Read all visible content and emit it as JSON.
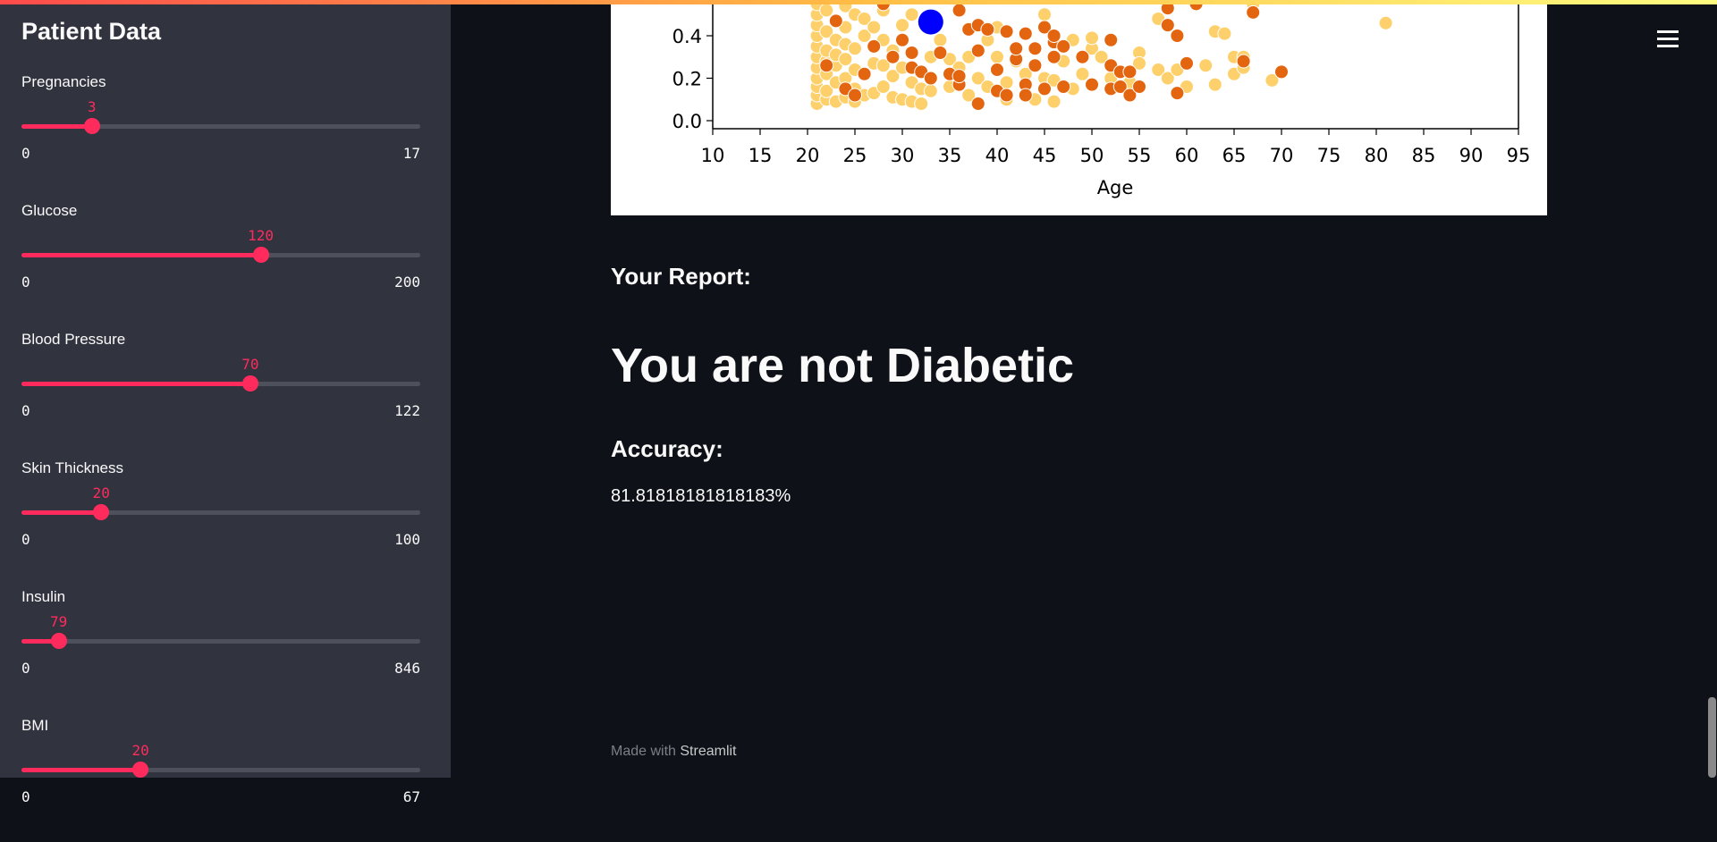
{
  "sidebar": {
    "title": "Patient Data",
    "sliders": [
      {
        "label": "Pregnancies",
        "value": 3,
        "min": 0,
        "max": 17
      },
      {
        "label": "Glucose",
        "value": 120,
        "min": 0,
        "max": 200
      },
      {
        "label": "Blood Pressure",
        "value": 70,
        "min": 0,
        "max": 122
      },
      {
        "label": "Skin Thickness",
        "value": 20,
        "min": 0,
        "max": 100
      },
      {
        "label": "Insulin",
        "value": 79,
        "min": 0,
        "max": 846
      },
      {
        "label": "BMI",
        "value": 20,
        "min": 0,
        "max": 67
      }
    ],
    "accent_color": "#ff2b5c"
  },
  "main": {
    "report_heading": "Your Report:",
    "verdict": "You are not Diabetic",
    "accuracy_heading": "Accuracy:",
    "accuracy_value": "81.81818181818183%",
    "footer_prefix": "Made with ",
    "footer_brand": "Streamlit",
    "menu_icon": "hamburger-icon"
  },
  "chart_data": {
    "type": "scatter",
    "xlabel": "Age",
    "xlim": [
      10,
      95
    ],
    "xticks": [
      10,
      15,
      20,
      25,
      30,
      35,
      40,
      45,
      50,
      55,
      60,
      65,
      70,
      75,
      80,
      85,
      90,
      95
    ],
    "yticks": [
      "0.0",
      "0.2",
      "0.4"
    ],
    "ylim_visible": [
      -0.04,
      0.57
    ],
    "grid": false,
    "series": [
      {
        "color": "#fdd06c",
        "points": [
          [
            21,
            0.08
          ],
          [
            21,
            0.12
          ],
          [
            21,
            0.16
          ],
          [
            21,
            0.2
          ],
          [
            21,
            0.25
          ],
          [
            21,
            0.3
          ],
          [
            21,
            0.35
          ],
          [
            21,
            0.4
          ],
          [
            21,
            0.45
          ],
          [
            21,
            0.5
          ],
          [
            21,
            0.55
          ],
          [
            22,
            0.1
          ],
          [
            22,
            0.14
          ],
          [
            22,
            0.22
          ],
          [
            22,
            0.28
          ],
          [
            22,
            0.33
          ],
          [
            22,
            0.42
          ],
          [
            22,
            0.52
          ],
          [
            23,
            0.09
          ],
          [
            23,
            0.18
          ],
          [
            23,
            0.26
          ],
          [
            23,
            0.31
          ],
          [
            23,
            0.38
          ],
          [
            23,
            0.47
          ],
          [
            24,
            0.11
          ],
          [
            24,
            0.2
          ],
          [
            24,
            0.29
          ],
          [
            24,
            0.36
          ],
          [
            24,
            0.44
          ],
          [
            24,
            0.54
          ],
          [
            25,
            0.09
          ],
          [
            25,
            0.15
          ],
          [
            25,
            0.24
          ],
          [
            25,
            0.34
          ],
          [
            25,
            0.5
          ],
          [
            26,
            0.12
          ],
          [
            26,
            0.22
          ],
          [
            26,
            0.4
          ],
          [
            26,
            0.48
          ],
          [
            27,
            0.13
          ],
          [
            27,
            0.27
          ],
          [
            27,
            0.44
          ],
          [
            28,
            0.16
          ],
          [
            28,
            0.26
          ],
          [
            28,
            0.38
          ],
          [
            28,
            0.52
          ],
          [
            29,
            0.11
          ],
          [
            29,
            0.21
          ],
          [
            29,
            0.33
          ],
          [
            30,
            0.1
          ],
          [
            30,
            0.25
          ],
          [
            30,
            0.45
          ],
          [
            31,
            0.09
          ],
          [
            31,
            0.18
          ],
          [
            31,
            0.5
          ],
          [
            32,
            0.08
          ],
          [
            32,
            0.15
          ],
          [
            33,
            0.3
          ],
          [
            33,
            0.14
          ],
          [
            34,
            0.38
          ],
          [
            35,
            0.16
          ],
          [
            35,
            0.29
          ],
          [
            36,
            0.25
          ],
          [
            37,
            0.12
          ],
          [
            37,
            0.3
          ],
          [
            38,
            0.2
          ],
          [
            39,
            0.16
          ],
          [
            39,
            0.38
          ],
          [
            40,
            0.44
          ],
          [
            40,
            0.3
          ],
          [
            41,
            0.1
          ],
          [
            41,
            0.18
          ],
          [
            42,
            0.28
          ],
          [
            43,
            0.22
          ],
          [
            44,
            0.1
          ],
          [
            45,
            0.2
          ],
          [
            45,
            0.5
          ],
          [
            46,
            0.09
          ],
          [
            46,
            0.19
          ],
          [
            47,
            0.28
          ],
          [
            48,
            0.15
          ],
          [
            48,
            0.38
          ],
          [
            49,
            0.22
          ],
          [
            50,
            0.34
          ],
          [
            50,
            0.39
          ],
          [
            51,
            0.3
          ],
          [
            52,
            0.2
          ],
          [
            54,
            0.18
          ],
          [
            55,
            0.32
          ],
          [
            55,
            0.27
          ],
          [
            57,
            0.24
          ],
          [
            57,
            0.48
          ],
          [
            58,
            0.2
          ],
          [
            59,
            0.24
          ],
          [
            60,
            0.16
          ],
          [
            62,
            0.26
          ],
          [
            63,
            0.17
          ],
          [
            63,
            0.42
          ],
          [
            64,
            0.41
          ],
          [
            65,
            0.22
          ],
          [
            65,
            0.3
          ],
          [
            66,
            0.25
          ],
          [
            66,
            0.3
          ],
          [
            67,
            0.55
          ],
          [
            69,
            0.19
          ],
          [
            81,
            0.46
          ]
        ]
      },
      {
        "color": "#e4650f",
        "points": [
          [
            22,
            0.26
          ],
          [
            23,
            0.47
          ],
          [
            24,
            0.15
          ],
          [
            25,
            0.12
          ],
          [
            26,
            0.22
          ],
          [
            27,
            0.35
          ],
          [
            28,
            0.55
          ],
          [
            29,
            0.3
          ],
          [
            30,
            0.38
          ],
          [
            31,
            0.32
          ],
          [
            31,
            0.25
          ],
          [
            32,
            0.23
          ],
          [
            33,
            0.2
          ],
          [
            34,
            0.32
          ],
          [
            35,
            0.22
          ],
          [
            36,
            0.17
          ],
          [
            36,
            0.21
          ],
          [
            36,
            0.52
          ],
          [
            37,
            0.43
          ],
          [
            38,
            0.08
          ],
          [
            38,
            0.33
          ],
          [
            38,
            0.45
          ],
          [
            39,
            0.43
          ],
          [
            40,
            0.24
          ],
          [
            40,
            0.14
          ],
          [
            41,
            0.12
          ],
          [
            41,
            0.42
          ],
          [
            42,
            0.29
          ],
          [
            42,
            0.34
          ],
          [
            43,
            0.17
          ],
          [
            43,
            0.12
          ],
          [
            43,
            0.41
          ],
          [
            44,
            0.34
          ],
          [
            44,
            0.26
          ],
          [
            45,
            0.15
          ],
          [
            45,
            0.44
          ],
          [
            46,
            0.3
          ],
          [
            46,
            0.37
          ],
          [
            46,
            0.4
          ],
          [
            47,
            0.35
          ],
          [
            47,
            0.16
          ],
          [
            49,
            0.3
          ],
          [
            50,
            0.17
          ],
          [
            52,
            0.15
          ],
          [
            52,
            0.38
          ],
          [
            52,
            0.26
          ],
          [
            53,
            0.23
          ],
          [
            53,
            0.16
          ],
          [
            54,
            0.12
          ],
          [
            54,
            0.23
          ],
          [
            55,
            0.16
          ],
          [
            58,
            0.45
          ],
          [
            58,
            0.53
          ],
          [
            59,
            0.13
          ],
          [
            59,
            0.4
          ],
          [
            60,
            0.27
          ],
          [
            61,
            0.55
          ],
          [
            66,
            0.28
          ],
          [
            67,
            0.51
          ],
          [
            70,
            0.23
          ]
        ]
      },
      {
        "color": "#0000ff",
        "highlight": true,
        "points": [
          [
            33,
            0.465
          ]
        ]
      }
    ]
  }
}
